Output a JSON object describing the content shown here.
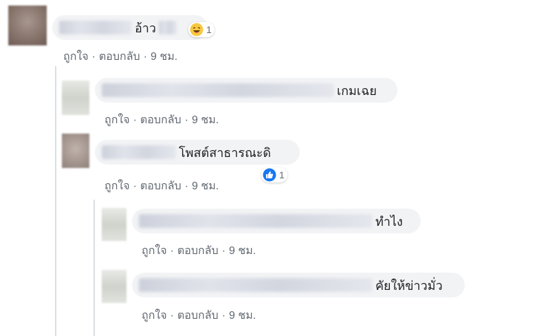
{
  "colors": {
    "bubble": "#f2f3f5",
    "meta_text": "#606770",
    "like_blue": "#1877f2",
    "haha_yellow": "#f7c842"
  },
  "comments": [
    {
      "text": "อ้าว",
      "like": "ถูกใจ",
      "sep1": "·",
      "reply": "ตอบกลับ",
      "sep2": "·",
      "time": "9 ชม.",
      "reaction": {
        "icon": "haha-emoji-icon",
        "count": "1"
      }
    },
    {
      "text": "เกมเฉย",
      "like": "ถูกใจ",
      "sep1": "·",
      "reply": "ตอบกลับ",
      "sep2": "·",
      "time": "9 ชม."
    },
    {
      "text": "โพสต์สาธารณะดิ",
      "like": "ถูกใจ",
      "sep1": "·",
      "reply": "ตอบกลับ",
      "sep2": "·",
      "time": "9 ชม.",
      "reaction": {
        "icon": "like-thumb-icon",
        "count": "1"
      }
    },
    {
      "text": "ทำไง",
      "like": "ถูกใจ",
      "sep1": "·",
      "reply": "ตอบกลับ",
      "sep2": "·",
      "time": "9 ชม."
    },
    {
      "text": "คัยให้ข่าวมั่ว",
      "like": "ถูกใจ",
      "sep1": "·",
      "reply": "ตอบกลับ",
      "sep2": "·",
      "time": "9 ชม."
    }
  ]
}
